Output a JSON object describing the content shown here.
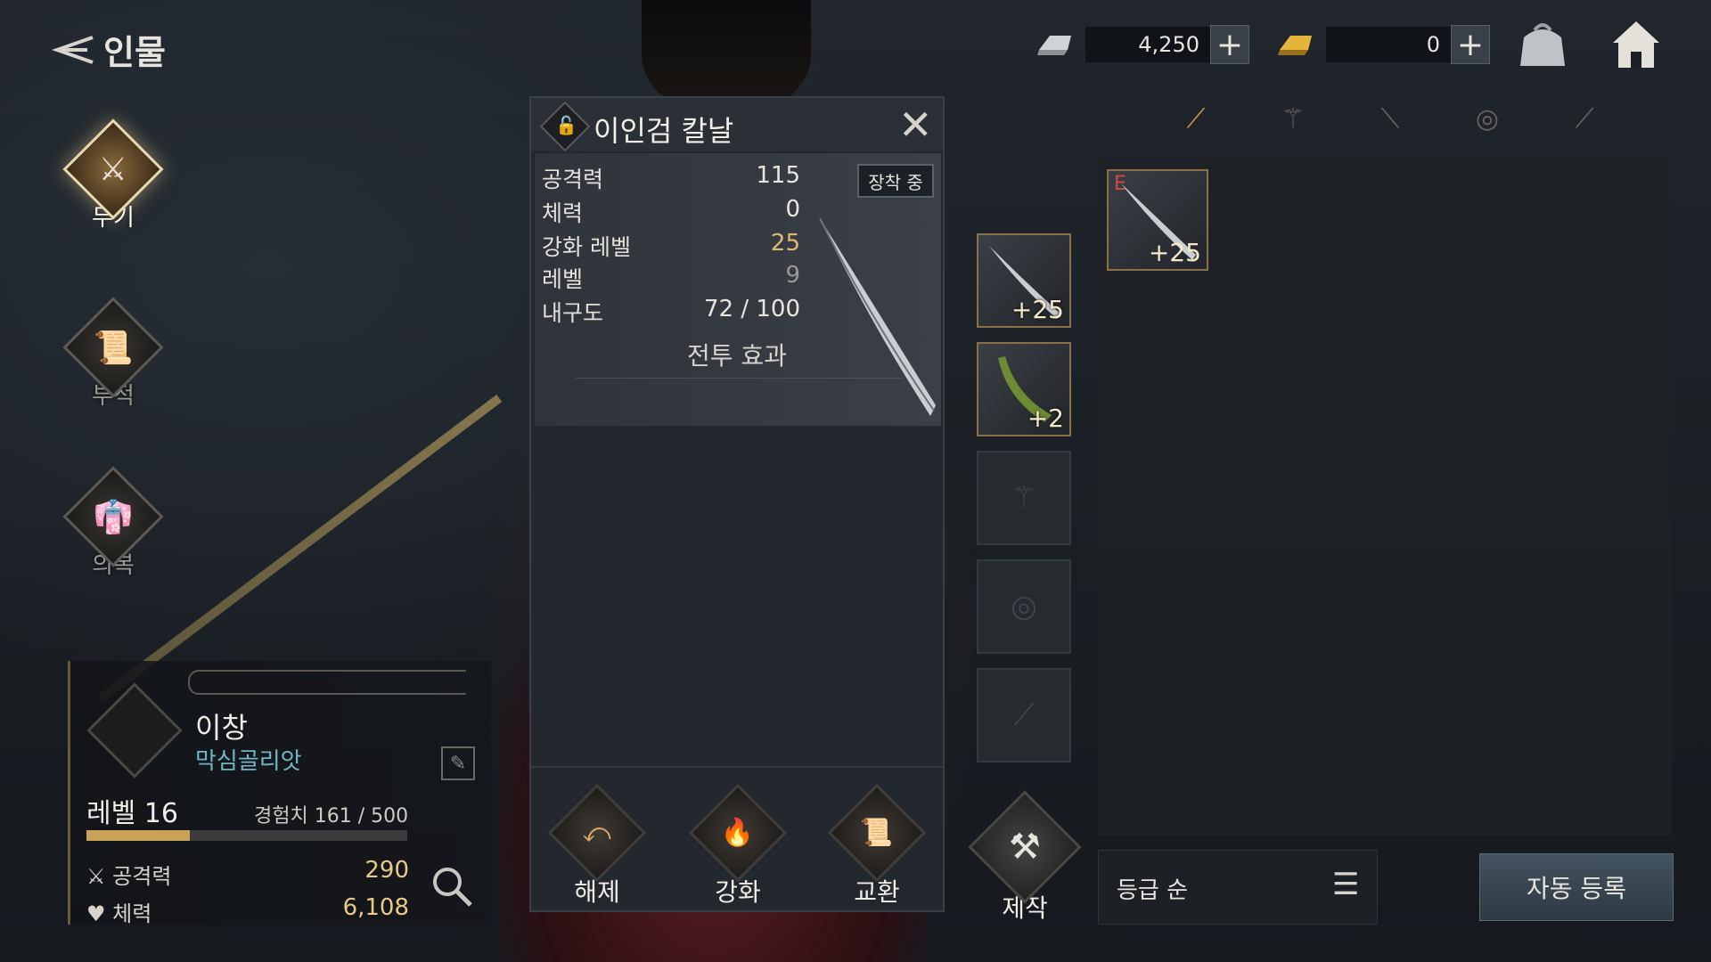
{
  "header": {
    "title": "인물",
    "currencies": [
      {
        "name": "silver-ingot",
        "amount": "4,250"
      },
      {
        "name": "gold-ingot",
        "amount": "0"
      }
    ],
    "plus_label": "+"
  },
  "categories": [
    {
      "label": "무기",
      "icon": "weapon-icon",
      "active": true
    },
    {
      "label": "부적",
      "icon": "talisman-icon",
      "active": false
    },
    {
      "label": "의복",
      "icon": "clothing-icon",
      "active": false
    }
  ],
  "character": {
    "name": "이창",
    "class": "막심골리앗",
    "level_label": "레벨 16",
    "exp_label": "경험치 161 / 500",
    "exp_current": 161,
    "exp_max": 500,
    "attack_label": "공격력",
    "attack_value": "290",
    "hp_label": "체력",
    "hp_value": "6,108"
  },
  "item": {
    "name": "이인검 칼날",
    "equipped_label": "장착 중",
    "stats": [
      {
        "label": "공격력",
        "value": "115"
      },
      {
        "label": "체력",
        "value": "0"
      },
      {
        "label": "강화 레벨",
        "value": "25"
      },
      {
        "label": "레벨",
        "value": "9"
      },
      {
        "label": "내구도",
        "value": "72 / 100"
      }
    ],
    "section_title": "전투 효과",
    "actions": [
      {
        "label": "해제",
        "icon": "unequip-icon"
      },
      {
        "label": "강화",
        "icon": "enhance-icon"
      },
      {
        "label": "교환",
        "icon": "exchange-icon"
      }
    ]
  },
  "slots": [
    {
      "level": "+25",
      "icon": "blade-icon"
    },
    {
      "level": "+2",
      "icon": "scabbard-icon"
    },
    {
      "level": "",
      "icon": "tassel-icon"
    },
    {
      "level": "",
      "icon": "guard-icon"
    },
    {
      "level": "",
      "icon": "handle-icon"
    }
  ],
  "craft_label": "제작",
  "inventory": {
    "tabs": [
      "blade-tab-icon",
      "tassel-tab-icon",
      "handle-tab-icon",
      "guard-tab-icon",
      "sword-tab-icon"
    ],
    "items": [
      {
        "grade": "E",
        "level": "+25"
      }
    ],
    "sort_label": "등급 순",
    "auto_register_label": "자동 등록"
  },
  "colors": {
    "accent_gold": "#e0b774",
    "class_cyan": "#6fb7c6",
    "grade_red": "#d24a3c"
  }
}
